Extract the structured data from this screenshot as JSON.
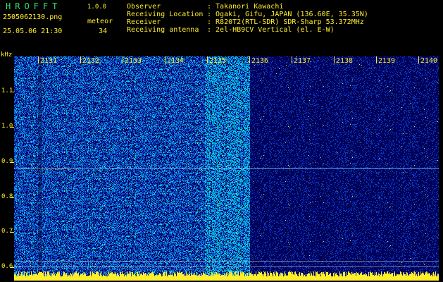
{
  "app": {
    "logo": "HROFFT",
    "version": "1.0.0"
  },
  "image": {
    "filename": "2505062130.png",
    "timestamp": "25.05.06 21:30"
  },
  "meteor": {
    "label": "meteor",
    "count": "34"
  },
  "meta": [
    {
      "key": "Observer",
      "value": ": Takanori Kawachi"
    },
    {
      "key": "Receiving Location",
      "value": ": Ogaki, Gifu, JAPAN (136.60E, 35.35N)"
    },
    {
      "key": "Receiver",
      "value": ": R820T2(RTL-SDR) SDR-Sharp 53.372MHz"
    },
    {
      "key": "Receiving antenna",
      "value": ": 2el-HB9CV Vertical (el. E-W)"
    }
  ],
  "axis": {
    "y_unit": "kHz",
    "y_ticks": [
      "1.1",
      "1.0",
      "0.9",
      "0.8",
      "0.7",
      "0.6"
    ],
    "x_ticks": [
      "2131",
      "2132",
      "2133",
      "2134",
      "2135",
      "2136",
      "2137",
      "2138",
      "2139",
      "2140"
    ]
  },
  "colors": {
    "text": "#ffef2a",
    "logo": "#2fe36b",
    "background": "#000000"
  }
}
